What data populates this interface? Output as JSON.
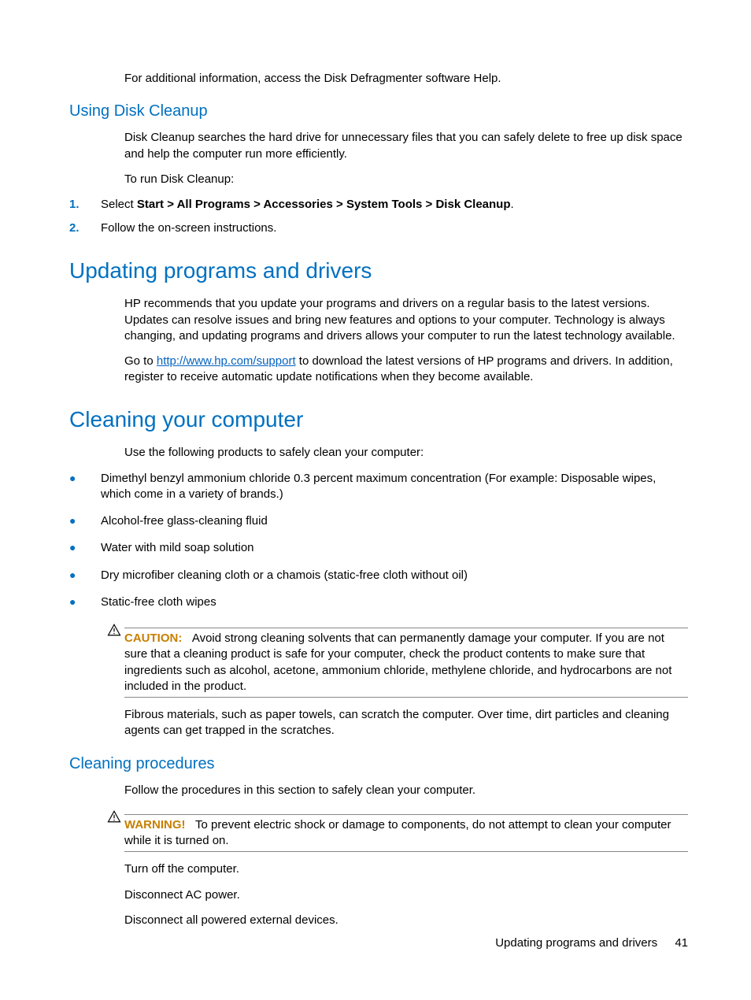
{
  "intro_para": "For additional information, access the Disk Defragmenter software Help.",
  "section1": {
    "heading": "Using Disk Cleanup",
    "p1": "Disk Cleanup searches the hard drive for unnecessary files that you can safely delete to free up disk space and help the computer run more efficiently.",
    "p2": "To run Disk Cleanup:",
    "steps": [
      {
        "num": "1.",
        "prefix": "Select ",
        "bold": "Start > All Programs > Accessories > System Tools > Disk Cleanup",
        "suffix": "."
      },
      {
        "num": "2.",
        "text": "Follow the on-screen instructions."
      }
    ]
  },
  "section2": {
    "heading": "Updating programs and drivers",
    "p1": "HP recommends that you update your programs and drivers on a regular basis to the latest versions. Updates can resolve issues and bring new features and options to your computer. Technology is always changing, and updating programs and drivers allows your computer to run the latest technology available.",
    "p2_pre": "Go to ",
    "p2_link": "http://www.hp.com/support",
    "p2_post": " to download the latest versions of HP programs and drivers. In addition, register to receive automatic update notifications when they become available."
  },
  "section3": {
    "heading": "Cleaning your computer",
    "p1": "Use the following products to safely clean your computer:",
    "bullets": [
      "Dimethyl benzyl ammonium chloride 0.3 percent maximum concentration (For example: Disposable wipes, which come in a variety of brands.)",
      "Alcohol-free glass-cleaning fluid",
      "Water with mild soap solution",
      "Dry microfiber cleaning cloth or a chamois (static-free cloth without oil)",
      "Static-free cloth wipes"
    ],
    "caution_label": "CAUTION:",
    "caution_text": "Avoid strong cleaning solvents that can permanently damage your computer. If you are not sure that a cleaning product is safe for your computer, check the product contents to make sure that ingredients such as alcohol, acetone, ammonium chloride, methylene chloride, and hydrocarbons are not included in the product.",
    "p2": "Fibrous materials, such as paper towels, can scratch the computer. Over time, dirt particles and cleaning agents can get trapped in the scratches."
  },
  "section4": {
    "heading": "Cleaning procedures",
    "p1": "Follow the procedures in this section to safely clean your computer.",
    "warning_label": "WARNING!",
    "warning_text": "To prevent electric shock or damage to components, do not attempt to clean your computer while it is turned on.",
    "p2": "Turn off the computer.",
    "p3": "Disconnect AC power.",
    "p4": "Disconnect all powered external devices."
  },
  "footer": {
    "text": "Updating programs and drivers",
    "page": "41"
  }
}
